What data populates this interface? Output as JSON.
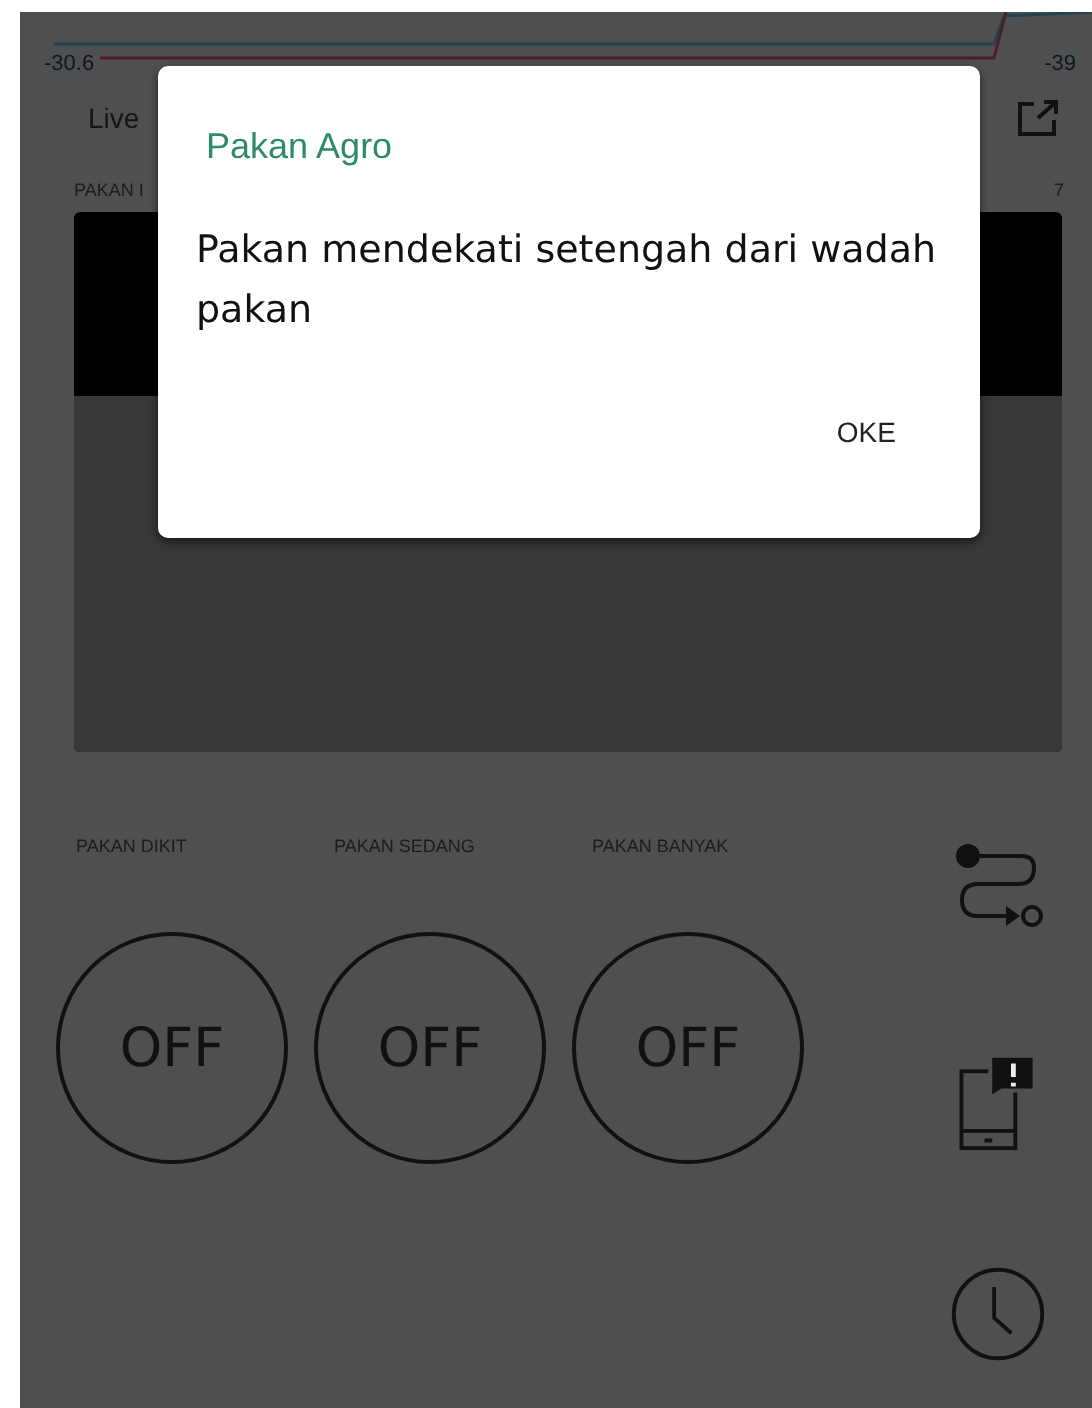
{
  "chart": {
    "min_label": "-30.6",
    "max_label": "-39",
    "range_label": "Live"
  },
  "level_widget": {
    "label": "PAKAN I",
    "value": "7"
  },
  "switches": [
    {
      "label": "PAKAN DIKIT",
      "text": "OFF",
      "on": false
    },
    {
      "label": "PAKAN SEDANG",
      "text": "OFF",
      "on": false
    },
    {
      "label": "PAKAN BANYAK",
      "text": "OFF",
      "on": false
    }
  ],
  "side_icons": [
    {
      "kind": "route"
    },
    {
      "kind": "phone-alert"
    },
    {
      "kind": "clock"
    }
  ],
  "dialog": {
    "title": "Pakan Agro",
    "message": "Pakan mendekati setengah dari wadah pakan",
    "button": "OKE"
  }
}
